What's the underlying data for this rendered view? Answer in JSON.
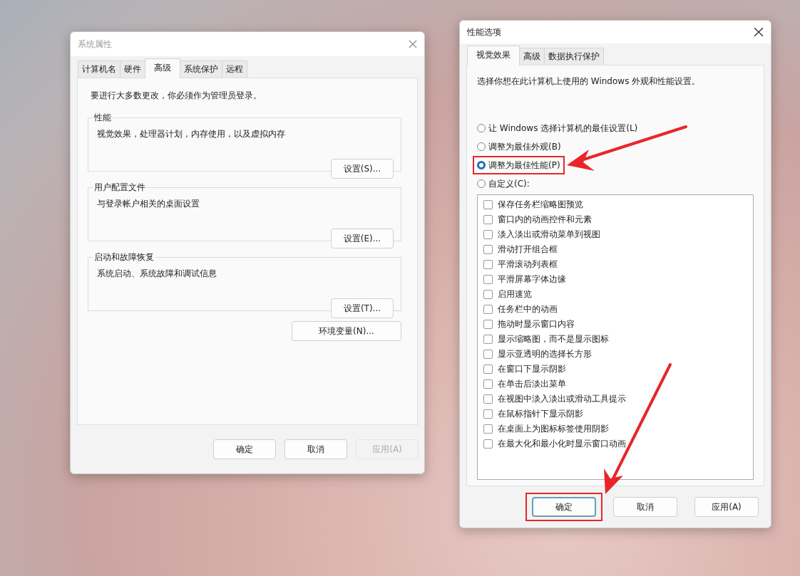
{
  "system_properties": {
    "title": "系统属性",
    "tabs": [
      {
        "label": "计算机名",
        "selected": false
      },
      {
        "label": "硬件",
        "selected": false
      },
      {
        "label": "高级",
        "selected": true
      },
      {
        "label": "系统保护",
        "selected": false
      },
      {
        "label": "远程",
        "selected": false
      }
    ],
    "notice": "要进行大多数更改，你必须作为管理员登录。",
    "groups": [
      {
        "title": "性能",
        "description": "视觉效果，处理器计划，内存使用，以及虚拟内存",
        "button": "设置(S)..."
      },
      {
        "title": "用户配置文件",
        "description": "与登录帐户相关的桌面设置",
        "button": "设置(E)..."
      },
      {
        "title": "启动和故障恢复",
        "description": "系统启动、系统故障和调试信息",
        "button": "设置(T)..."
      }
    ],
    "env_button": "环境变量(N)...",
    "buttons": [
      {
        "label": "确定",
        "disabled": false
      },
      {
        "label": "取消",
        "disabled": false
      },
      {
        "label": "应用(A)",
        "disabled": true
      }
    ]
  },
  "performance_options": {
    "title": "性能选项",
    "tabs": [
      {
        "label": "视觉效果",
        "selected": true
      },
      {
        "label": "高级",
        "selected": false
      },
      {
        "label": "数据执行保护",
        "selected": false
      }
    ],
    "intro": "选择你想在此计算机上使用的 Windows 外观和性能设置。",
    "options": [
      {
        "label": "让 Windows 选择计算机的最佳设置(L)",
        "selected": false,
        "highlighted": false
      },
      {
        "label": "调整为最佳外观(B)",
        "selected": false,
        "highlighted": false
      },
      {
        "label": "调整为最佳性能(P)",
        "selected": true,
        "highlighted": true
      },
      {
        "label": "自定义(C):",
        "selected": false,
        "highlighted": false
      }
    ],
    "effects": [
      {
        "label": "保存任务栏缩略图预览",
        "checked": false
      },
      {
        "label": "窗口内的动画控件和元素",
        "checked": false
      },
      {
        "label": "淡入淡出或滑动菜单到视图",
        "checked": false
      },
      {
        "label": "滑动打开组合框",
        "checked": false
      },
      {
        "label": "平滑滚动列表框",
        "checked": false
      },
      {
        "label": "平滑屏幕字体边缘",
        "checked": false
      },
      {
        "label": "启用速览",
        "checked": false
      },
      {
        "label": "任务栏中的动画",
        "checked": false
      },
      {
        "label": "拖动时显示窗口内容",
        "checked": false
      },
      {
        "label": "显示缩略图，而不是显示图标",
        "checked": false
      },
      {
        "label": "显示亚透明的选择长方形",
        "checked": false
      },
      {
        "label": "在窗口下显示阴影",
        "checked": false
      },
      {
        "label": "在单击后淡出菜单",
        "checked": false
      },
      {
        "label": "在视图中淡入淡出或滑动工具提示",
        "checked": false
      },
      {
        "label": "在鼠标指针下显示阴影",
        "checked": false
      },
      {
        "label": "在桌面上为图标标签使用阴影",
        "checked": false
      },
      {
        "label": "在最大化和最小化时显示窗口动画",
        "checked": false
      }
    ],
    "buttons": [
      {
        "label": "确定",
        "default": true,
        "highlighted": true
      },
      {
        "label": "取消",
        "default": false,
        "highlighted": false
      },
      {
        "label": "应用(A)",
        "default": false,
        "highlighted": false
      }
    ]
  }
}
